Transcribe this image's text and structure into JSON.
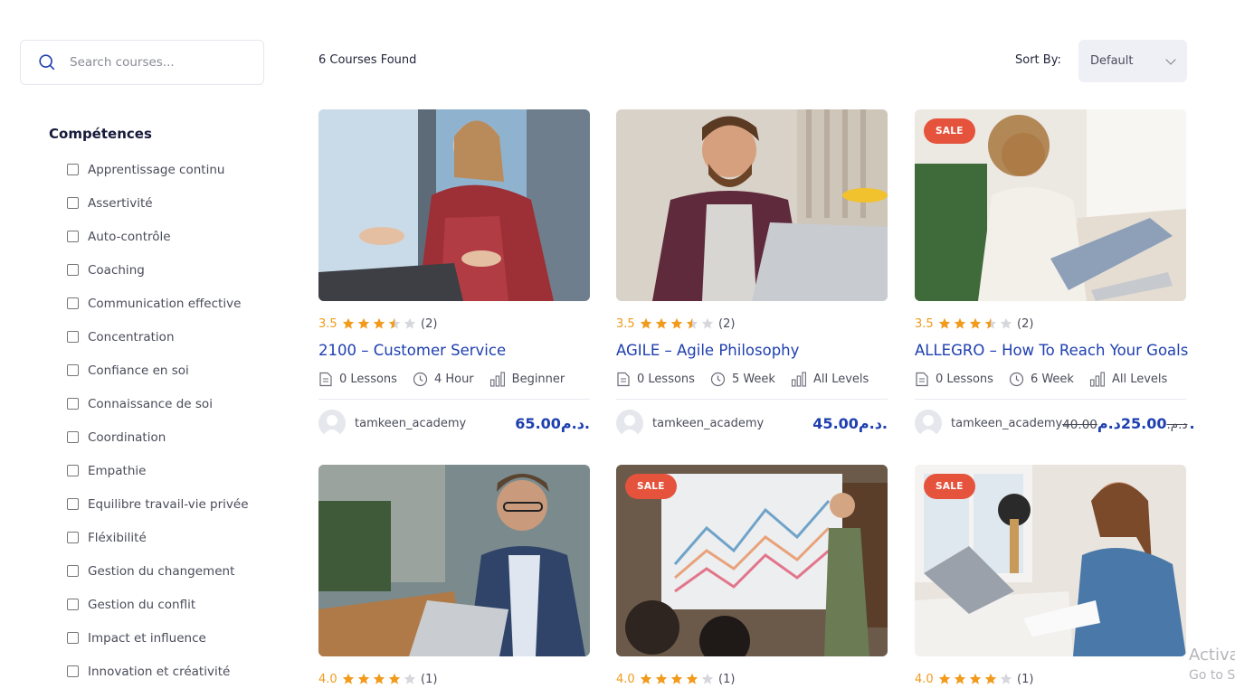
{
  "search": {
    "placeholder": "Search courses..."
  },
  "filters": {
    "title": "Compétences",
    "items": [
      "Apprentissage continu",
      "Assertivité",
      "Auto-contrôle",
      "Coaching",
      "Communication effective",
      "Concentration",
      "Confiance en soi",
      "Connaissance de soi",
      "Coordination",
      "Empathie",
      "Equilibre travail-vie privée",
      "Fléxibilité",
      "Gestion du changement",
      "Gestion du conflit",
      "Impact et influence",
      "Innovation et créativité"
    ]
  },
  "header": {
    "found": "6 Courses Found",
    "sort_label": "Sort By:",
    "sort_value": "Default"
  },
  "courses": [
    {
      "rating": "3.5",
      "stars": 3.5,
      "count": "(2)",
      "title": "2100 – Customer Service",
      "lessons": "0 Lessons",
      "duration": "4 Hour",
      "level": "Beginner",
      "author": "tamkeen_academy",
      "price": "65.00د.م.",
      "old_price": "",
      "sale": ""
    },
    {
      "rating": "3.5",
      "stars": 3.5,
      "count": "(2)",
      "title": "AGILE – Agile Philosophy",
      "lessons": "0 Lessons",
      "duration": "5 Week",
      "level": "All Levels",
      "author": "tamkeen_academy",
      "price": "45.00د.م.",
      "old_price": "",
      "sale": ""
    },
    {
      "rating": "3.5",
      "stars": 3.5,
      "count": "(2)",
      "title": "ALLEGRO – How To Reach Your Goals",
      "lessons": "0 Lessons",
      "duration": "6 Week",
      "level": "All Levels",
      "author": "tamkeen_academy",
      "price": "25.00د.م.",
      "old_price": "40.00د.م.",
      "sale": "SALE"
    },
    {
      "rating": "4.0",
      "stars": 4,
      "count": "(1)",
      "sale": ""
    },
    {
      "rating": "4.0",
      "stars": 4,
      "count": "(1)",
      "sale": "SALE"
    },
    {
      "rating": "4.0",
      "stars": 4,
      "count": "(1)",
      "sale": "SALE"
    }
  ],
  "watermark": {
    "line1": "Activa",
    "line2": "Go to Se"
  },
  "colors": {
    "accent": "#1e3fb0",
    "star": "#f29a1c",
    "sale": "#e5533c"
  }
}
